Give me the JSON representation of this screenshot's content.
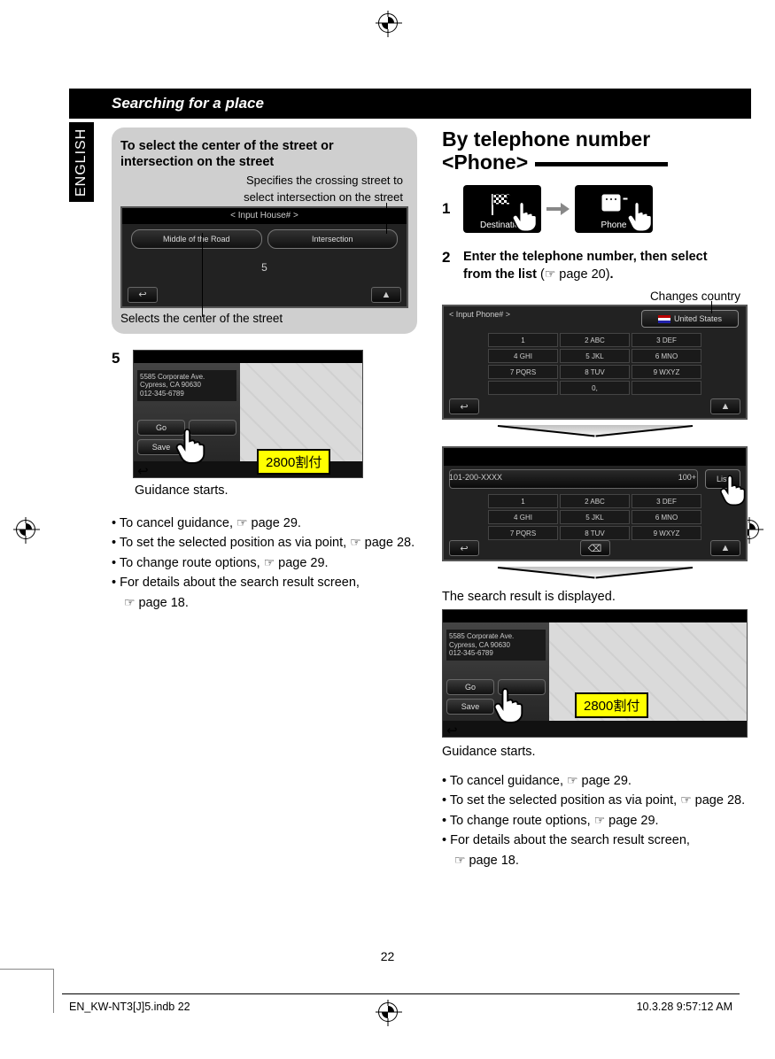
{
  "header": {
    "title": "Searching for a place"
  },
  "langTab": "ENGLISH",
  "leftCol": {
    "graybox": {
      "title": " To select the center of the street or intersection on the street",
      "calloutTop1": "Specifies the crossing street to",
      "calloutTop2": "select intersection on the street",
      "screenTitle": "< Input House# >",
      "btnMiddle": "Middle of the Road",
      "btnIntersection": "Intersection",
      "num": "5",
      "calloutBottom": "Selects the center of the street"
    },
    "step5": {
      "num": "5",
      "addr1": "5585 Corporate Ave.",
      "addr2": "Cypress, CA 90630",
      "addr3": "012-345-6789",
      "go": "Go",
      "save": "Save",
      "yellow": "2800割付",
      "guidance": "Guidance starts."
    },
    "bullets": {
      "b1a": "To cancel guidance, ",
      "b1b": " page 29.",
      "b2a": "To set the selected position as via point, ",
      "b2b": " page 28.",
      "b3a": "To change route options, ",
      "b3b": " page 29.",
      "b4a": "For details about the search result screen,",
      "b4b": " page 18."
    }
  },
  "rightCol": {
    "heading1": "By telephone number",
    "heading2": "<Phone>",
    "step1": {
      "num": "1",
      "destLabel": "Destination",
      "phoneLabel": "Phone"
    },
    "step2": {
      "num": "2",
      "line1": "Enter the telephone number, then select",
      "line2a": "from the list",
      "line2b": " (",
      "line2c": " page 20)",
      "line2d": ".",
      "changesCountry": "Changes country",
      "screen1Title": "< Input Phone# >",
      "usLabel": "United States",
      "keys": [
        "1",
        "2 ABC",
        "3 DEF",
        "4 GHI",
        "5 JKL",
        "6 MNO",
        "7 PQRS",
        "8 TUV",
        "9 WXYZ",
        "",
        "0,",
        ""
      ],
      "screen2Left": "101-200-XXXX",
      "screen2Count": "100+",
      "listLabel": "List",
      "resultText": "The search result is displayed.",
      "yellow": "2800割付",
      "guidance": "Guidance starts."
    },
    "bullets": {
      "b1a": "To cancel guidance, ",
      "b1b": " page 29.",
      "b2a": "To set the selected position as via point, ",
      "b2b": " page 28.",
      "b3a": "To change route options, ",
      "b3b": " page 29.",
      "b4a": "For details about the search result screen,",
      "b4b": " page 18."
    }
  },
  "footer": {
    "pageNum": "22",
    "left": "EN_KW-NT3[J]5.indb   22",
    "right": "10.3.28   9:57:12 AM"
  }
}
